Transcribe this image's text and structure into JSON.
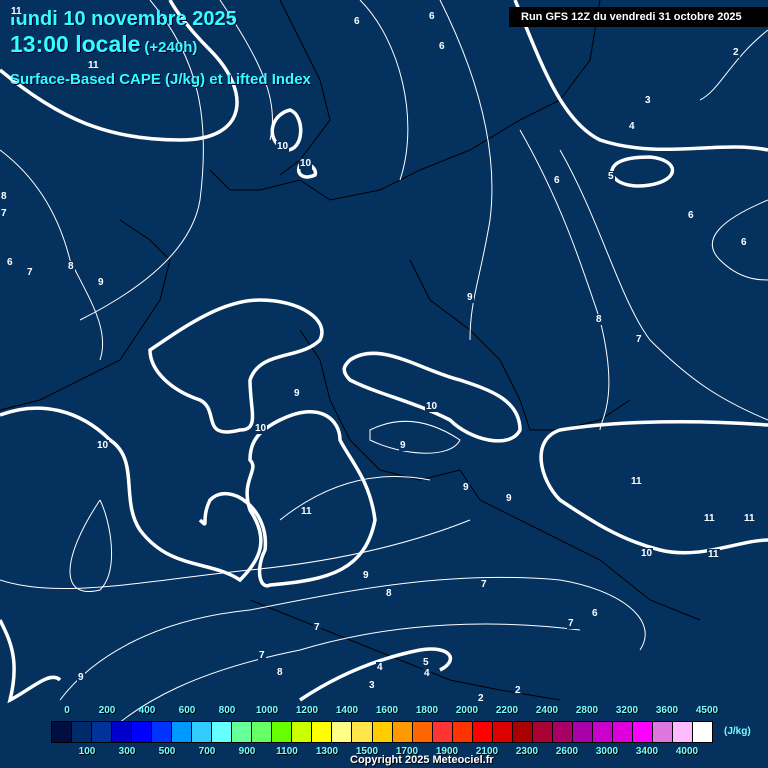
{
  "header": {
    "date": "lundi 10 novembre 2025",
    "time": "13:00 locale",
    "lead": "(+240h)",
    "parameter": "Surface-Based CAPE (J/kg) et Lifted Index",
    "run": "Run GFS 12Z du vendredi 31 octobre 2025"
  },
  "contour_labels": [
    "11",
    "11",
    "6",
    "6",
    "6",
    "2",
    "3",
    "4",
    "10",
    "10",
    "6",
    "5",
    "8",
    "7",
    "6",
    "7",
    "8",
    "9",
    "6",
    "6",
    "9",
    "8",
    "7",
    "9",
    "10",
    "10",
    "9",
    "10",
    "9",
    "9",
    "11",
    "11",
    "11",
    "11",
    "10",
    "11",
    "9",
    "8",
    "7",
    "6",
    "7",
    "7",
    "7",
    "8",
    "9",
    "5",
    "4",
    "4",
    "3",
    "2",
    "2"
  ],
  "legend": {
    "colors": [
      "#000f3f",
      "#002b6b",
      "#003399",
      "#0000cc",
      "#0000ff",
      "#0033ff",
      "#0099ff",
      "#33ccff",
      "#66ffff",
      "#66ff99",
      "#66ff66",
      "#66ff00",
      "#ccff00",
      "#ffff00",
      "#ffff88",
      "#ffe44a",
      "#ffcc00",
      "#ff9900",
      "#ff6600",
      "#ff3333",
      "#ff3300",
      "#ff0000",
      "#dd0000",
      "#aa0000",
      "#aa0033",
      "#aa0066",
      "#aa00aa",
      "#cc00cc",
      "#dd00dd",
      "#ff00ff",
      "#dd77dd",
      "#ffbbff",
      "#ffffff"
    ],
    "top_labels": [
      "0",
      "200",
      "400",
      "600",
      "800",
      "1000",
      "1200",
      "1400",
      "1600",
      "1800",
      "2000",
      "2200",
      "2400",
      "2800",
      "3200",
      "3600",
      "4500"
    ],
    "bottom_labels": [
      "100",
      "300",
      "500",
      "700",
      "900",
      "1100",
      "1300",
      "1500",
      "1700",
      "1900",
      "2100",
      "2300",
      "2600",
      "3000",
      "3400",
      "4000"
    ],
    "unit": "(J/kg)"
  },
  "copyright": "Copyright 2025 Meteociel.fr"
}
